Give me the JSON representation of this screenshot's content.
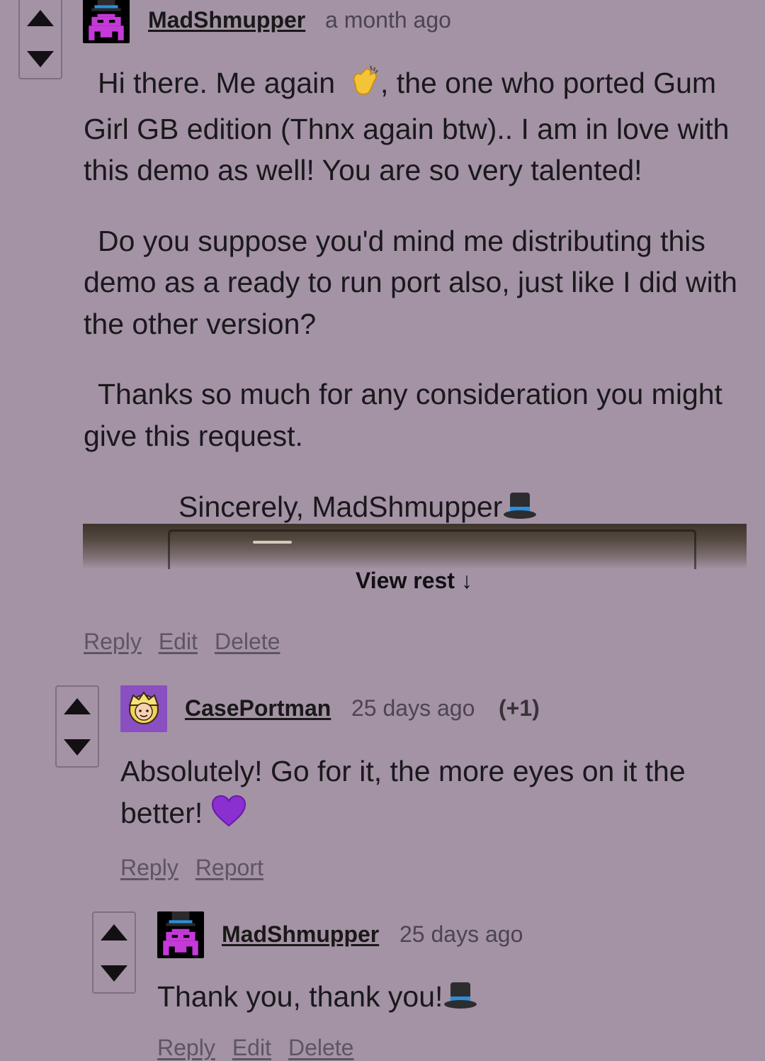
{
  "comments": [
    {
      "username": "MadShmupper",
      "time": "a month ago",
      "avatar_icon": "space-invader-tophat-icon",
      "paragraphs": [
        "Hi there. Me again",
        ", the one who ported Gum Girl GB edition (Thnx again btw).. I am in love with this demo as well! You are so very talented!",
        "Do you suppose you'd mind me distributing this demo as a ready to run port also, just like I did with the other version?",
        "Thanks so much for any consideration you might give this request.",
        "Sincerely, MadShmupper"
      ],
      "view_rest": "View rest ↓",
      "actions": [
        "Reply",
        "Edit",
        "Delete"
      ]
    },
    {
      "username": "CasePortman",
      "time": "25 days ago",
      "score": "(+1)",
      "avatar_icon": "blonde-face-icon",
      "paragraphs": [
        "Absolutely! Go for it, the more eyes on it the better!"
      ],
      "actions": [
        "Reply",
        "Report"
      ]
    },
    {
      "username": "MadShmupper",
      "time": "25 days ago",
      "avatar_icon": "space-invader-tophat-icon",
      "paragraphs": [
        "Thank you, thank you!"
      ],
      "actions": [
        "Reply",
        "Edit",
        "Delete"
      ]
    }
  ],
  "colors": {
    "background": "#a393a5",
    "vote_border": "#7d7080",
    "avatar_purple": "#8a4fc0",
    "invader_magenta": "#c43ad8",
    "hat_blue": "#2a8fdc"
  }
}
